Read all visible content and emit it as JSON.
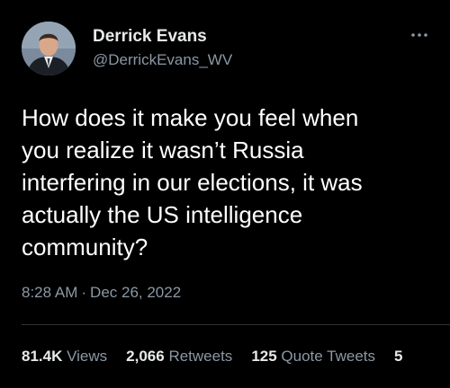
{
  "author": {
    "display_name": "Derrick Evans",
    "handle": "@DerrickEvans_WV"
  },
  "more_icon": "more-horizontal-icon",
  "tweet": {
    "text_lines": [
      "How does it make you feel when",
      "you realize it wasn’t Russia",
      "interfering in our elections, it was",
      "actually the US intelligence",
      "community?"
    ],
    "time": "8:28 AM",
    "separator": "·",
    "date": "Dec 26, 2022"
  },
  "stats": [
    {
      "value": "81.4K",
      "label": "Views"
    },
    {
      "value": "2,066",
      "label": "Retweets"
    },
    {
      "value": "125",
      "label": "Quote Tweets"
    },
    {
      "value": "5",
      "label": ""
    }
  ],
  "colors": {
    "background": "#000000",
    "primary_text": "#e7e9ea",
    "secondary_text": "#8b98a5",
    "divider": "#2f3336"
  }
}
